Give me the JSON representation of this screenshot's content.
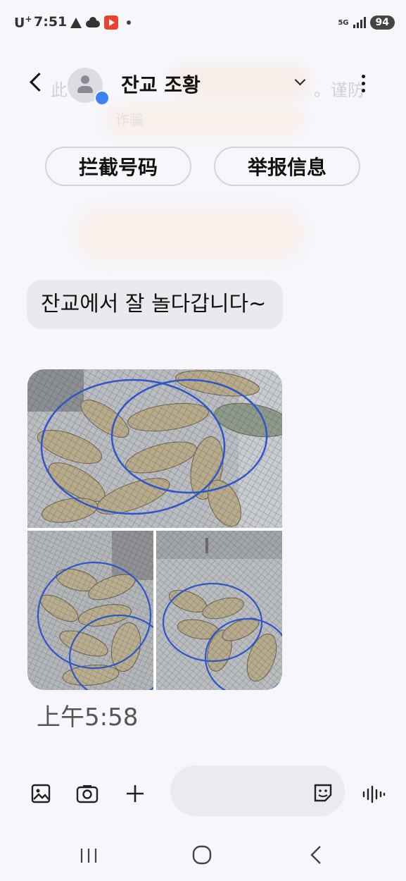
{
  "status_bar": {
    "carrier": "U",
    "carrier_sup": "+",
    "time": "7:51",
    "network": "5G",
    "battery": "94"
  },
  "header": {
    "contact_name": "잔교 조황",
    "ghost_left": "此 息",
    "ghost_right": "。谨防",
    "ghost_sub": "诈骗"
  },
  "actions": {
    "block_label": "拦截号码",
    "report_label": "举报信息"
  },
  "message": {
    "text": "잔교에서 잘 놀다갑니다~",
    "time": "上午5:58"
  },
  "colors": {
    "background": "#f6f6fb",
    "bubble": "#e9e9ee",
    "accent_dot": "#3b82f6"
  },
  "icons": {
    "composer": [
      "image-icon",
      "camera-icon",
      "plus-icon",
      "sticker-icon",
      "voice-icon"
    ],
    "nav": [
      "recents-icon",
      "home-icon",
      "back-nav-icon"
    ]
  }
}
